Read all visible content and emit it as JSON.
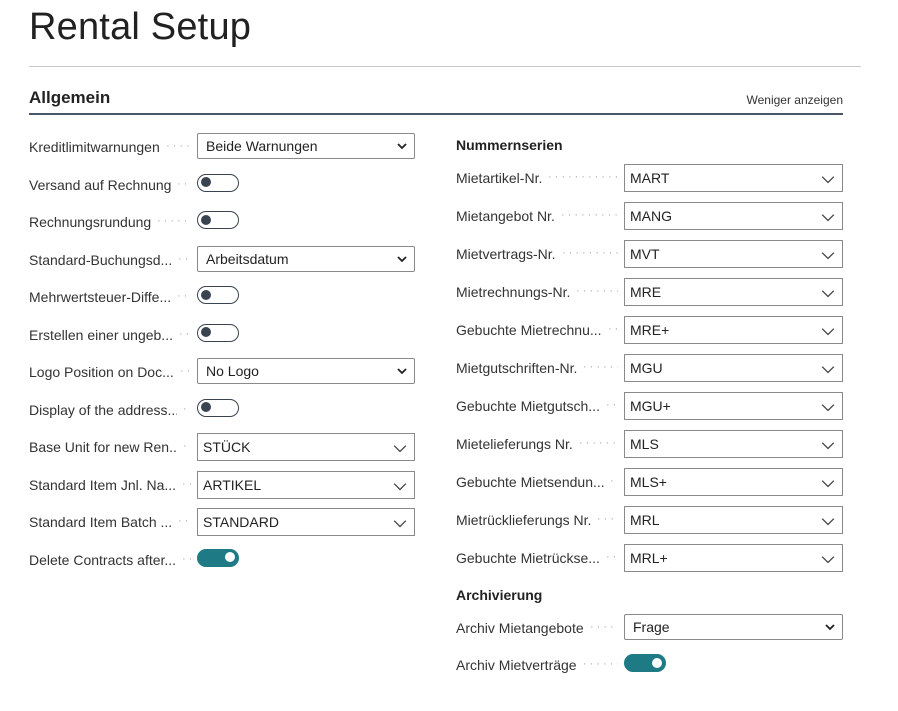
{
  "page": {
    "title": "Rental Setup"
  },
  "section": {
    "title": "Allgemein",
    "toggle_label": "Weniger anzeigen"
  },
  "left_fields": [
    {
      "label": "Kreditlimitwarnungen",
      "type": "select",
      "value": "Beide Warnungen"
    },
    {
      "label": "Versand auf Rechnung",
      "type": "toggle",
      "value": false
    },
    {
      "label": "Rechnungsrundung",
      "type": "toggle",
      "value": false
    },
    {
      "label": "Standard-Buchungsd...",
      "type": "select",
      "value": "Arbeitsdatum"
    },
    {
      "label": "Mehrwertsteuer-Diffe...",
      "type": "toggle",
      "value": false
    },
    {
      "label": "Erstellen einer ungeb...",
      "type": "toggle",
      "value": false
    },
    {
      "label": "Logo Position on Doc...",
      "type": "select",
      "value": "No Logo"
    },
    {
      "label": "Display of the address...",
      "type": "toggle",
      "value": false
    },
    {
      "label": "Base Unit for new Ren...",
      "type": "lookup",
      "value": "STÜCK"
    },
    {
      "label": "Standard Item Jnl. Na...",
      "type": "lookup",
      "value": "ARTIKEL"
    },
    {
      "label": "Standard Item Batch ...",
      "type": "lookup",
      "value": "STANDARD"
    },
    {
      "label": "Delete Contracts after...",
      "type": "toggle",
      "value": true
    }
  ],
  "number_series": {
    "heading": "Nummernserien",
    "fields": [
      {
        "label": "Mietartikel-Nr.",
        "value": "MART"
      },
      {
        "label": "Mietangebot Nr.",
        "value": "MANG"
      },
      {
        "label": "Mietvertrags-Nr.",
        "value": "MVT"
      },
      {
        "label": "Mietrechnungs-Nr.",
        "value": "MRE"
      },
      {
        "label": "Gebuchte Mietrechnu...",
        "value": "MRE+"
      },
      {
        "label": "Mietgutschriften-Nr.",
        "value": "MGU"
      },
      {
        "label": "Gebuchte Mietgutsch...",
        "value": "MGU+"
      },
      {
        "label": "Mietelieferungs Nr.",
        "value": "MLS"
      },
      {
        "label": "Gebuchte Mietsendun...",
        "value": "MLS+"
      },
      {
        "label": "Mietrücklieferungs Nr.",
        "value": "MRL"
      },
      {
        "label": "Gebuchte Mietrückse...",
        "value": "MRL+"
      }
    ]
  },
  "archiving": {
    "heading": "Archivierung",
    "fields": [
      {
        "label": "Archiv Mietangebote",
        "type": "select",
        "value": "Frage"
      },
      {
        "label": "Archiv Mietverträge",
        "type": "toggle",
        "value": true
      }
    ]
  },
  "colors": {
    "accent": "#1e7b85",
    "header_rule": "#4a5568",
    "border": "#8a8a8a"
  }
}
